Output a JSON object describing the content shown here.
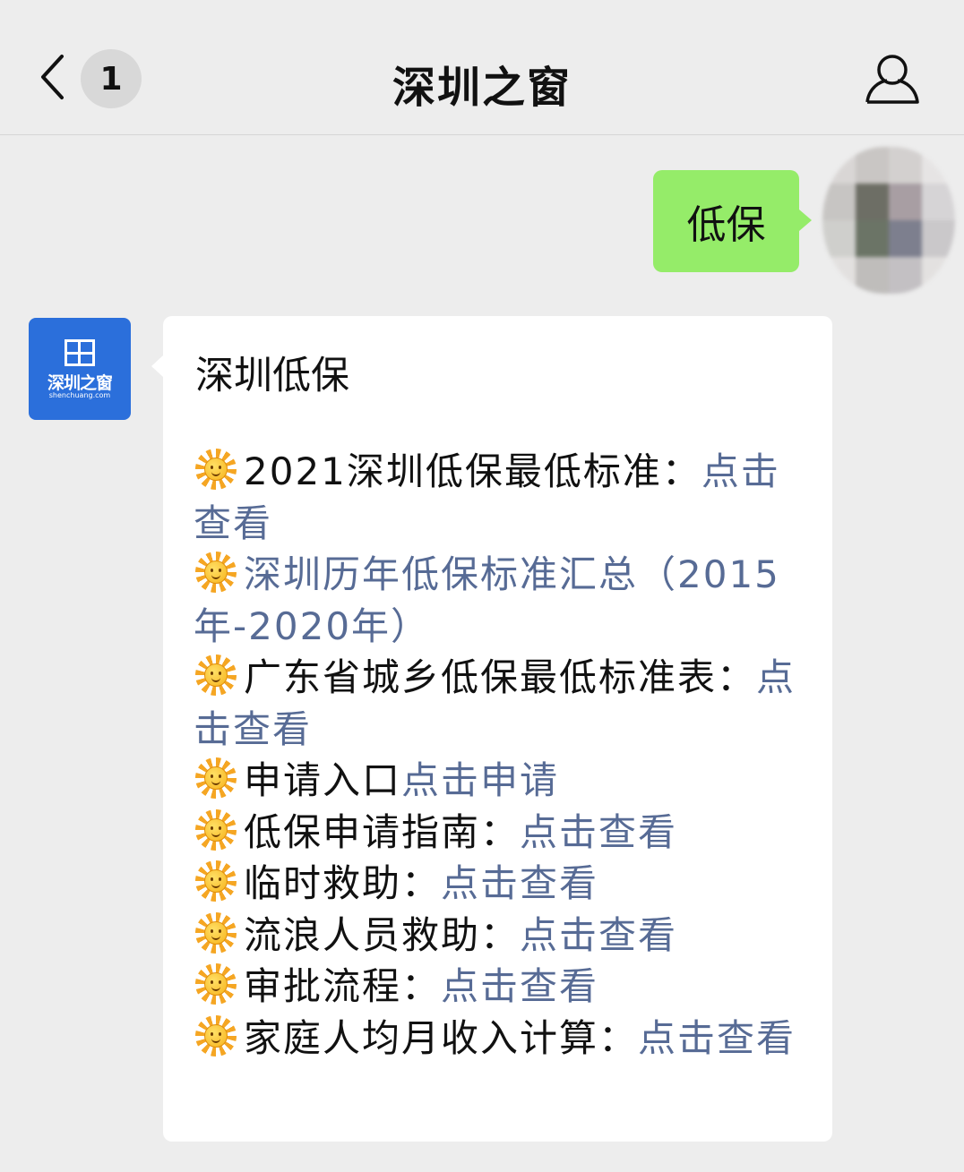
{
  "header": {
    "back_icon": "chevron-left-icon",
    "unread_count": "1",
    "title": "深圳之窗",
    "profile_icon": "person-icon"
  },
  "sent_message": {
    "text": "低保"
  },
  "official_account": {
    "avatar_name": "深圳之窗",
    "avatar_domain": "shenchuang.com",
    "brand_color": "#2b6fdb"
  },
  "reply": {
    "title": "深圳低保",
    "items": [
      {
        "icon": "sun-emoji-icon",
        "text": "2021深圳低保最低标准：",
        "link": "点击查看"
      },
      {
        "icon": "sun-emoji-icon",
        "text": "",
        "link": "深圳历年低保标准汇总（2015年-2020年）"
      },
      {
        "icon": "sun-emoji-icon",
        "text": "广东省城乡低保最低标准表：",
        "link": "点击查看"
      },
      {
        "icon": "sun-emoji-icon",
        "text": "申请入口",
        "link": "点击申请"
      },
      {
        "icon": "sun-emoji-icon",
        "text": "低保申请指南：",
        "link": "点击查看"
      },
      {
        "icon": "sun-emoji-icon",
        "text": "临时救助：",
        "link": "点击查看"
      },
      {
        "icon": "sun-emoji-icon",
        "text": "流浪人员救助：",
        "link": "点击查看"
      },
      {
        "icon": "sun-emoji-icon",
        "text": "审批流程：",
        "link": "点击查看"
      },
      {
        "icon": "sun-emoji-icon",
        "text": "家庭人均月收入计算：",
        "link": "点击查看"
      }
    ]
  },
  "colors": {
    "background": "#ededed",
    "sent_bubble": "#95ec69",
    "link": "#576b95"
  }
}
